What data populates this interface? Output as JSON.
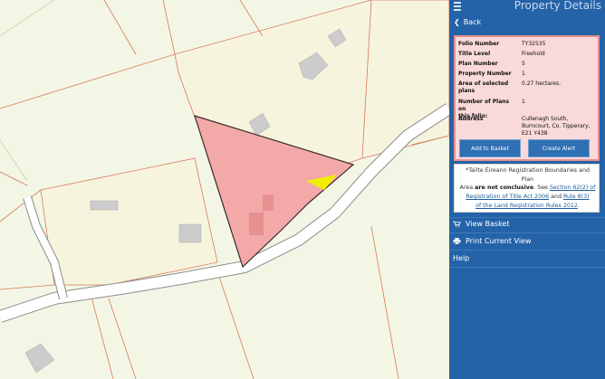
{
  "header": {
    "title": "Property Details",
    "menu_icon": "hamburger-menu-icon"
  },
  "back": {
    "label": "Back",
    "icon": "chevron-left-icon"
  },
  "property": {
    "folio_label": "Folio Number",
    "folio_value": "TY32535",
    "title_label": "Title Level",
    "title_value": "Freehold",
    "plan_label": "Plan Number",
    "plan_value": "5",
    "propnum_label": "Property Number",
    "propnum_value": "1",
    "area_label_1": "Area of selected",
    "area_label_2": "plans",
    "area_value": "0.27 hectares.",
    "numplans_label_1": "Number of Plans on",
    "numplans_label_2": "this folio:",
    "numplans_value": "1",
    "address_label": "Address",
    "address_line1": "Cullenagh South,",
    "address_line2": "Burncourt, Co. Tipperary,",
    "address_line3": "E21 Y438"
  },
  "buttons": {
    "add_to_basket": "Add to Basket",
    "create_alert": "Create Alert"
  },
  "notice": {
    "l1": "*Tailte Éireann Registration Boundaries and Plan",
    "l2a": "Area ",
    "l2b": "are not conclusive",
    "l2c": ". See ",
    "l2link": "Section 62(2) of",
    "l3link": "Registration of Title Act 2006",
    "l3b": " and ",
    "l3link2": "Rule 8(3)",
    "l4link": "of the Land Registration Rules 2012",
    "l4b": "."
  },
  "menu": {
    "view_basket": "View Basket",
    "view_basket_icon": "cart-icon",
    "print": "Print Current View",
    "print_icon": "printer-icon",
    "help": "Help"
  },
  "colors": {
    "panel": "#2563a8",
    "selected_plan": "#f4a9a9",
    "highlight": "#f2ee00",
    "map_bg": "#f3f6e4"
  }
}
